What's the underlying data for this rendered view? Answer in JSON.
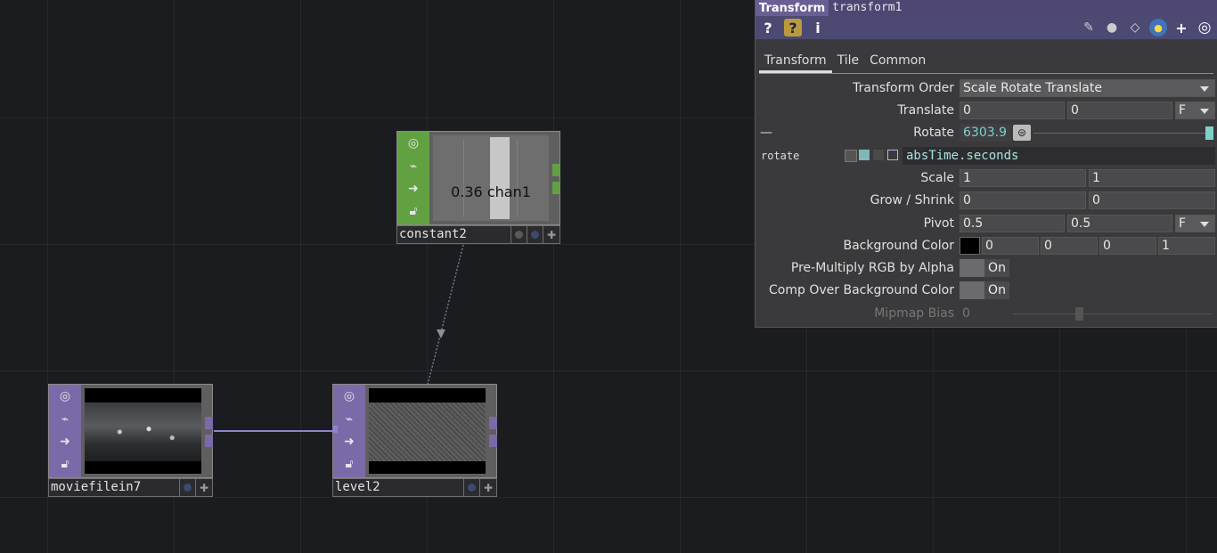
{
  "nodes": {
    "constant2": {
      "name": "constant2",
      "value_label": "0.36 chan1",
      "color": "#5f9d3c"
    },
    "moviefilein7": {
      "name": "moviefilein7",
      "color": "#7a6aa8"
    },
    "level2": {
      "name": "level2",
      "color": "#7a6aa8"
    }
  },
  "panel": {
    "op_type": "Transform",
    "op_name": "transform1",
    "toolbar_left": [
      "?",
      "?",
      "i"
    ],
    "tabs": [
      "Transform",
      "Tile",
      "Common"
    ],
    "active_tab": "Transform",
    "params": {
      "transform_order": {
        "label": "Transform Order",
        "value": "Scale Rotate Translate"
      },
      "translate": {
        "label": "Translate",
        "values": [
          "0",
          "0"
        ],
        "unit": "F"
      },
      "rotate": {
        "label": "Rotate",
        "value": "6303.9",
        "collapse": "—",
        "expr_name": "rotate",
        "expression": "absTime.seconds"
      },
      "scale": {
        "label": "Scale",
        "values": [
          "1",
          "1"
        ]
      },
      "grow_shrink": {
        "label": "Grow / Shrink",
        "values": [
          "0",
          "0"
        ]
      },
      "pivot": {
        "label": "Pivot",
        "values": [
          "0.5",
          "0.5"
        ],
        "unit": "F"
      },
      "bg_color": {
        "label": "Background Color",
        "values": [
          "0",
          "0",
          "0",
          "1"
        ],
        "swatch": "#000000"
      },
      "premultiply": {
        "label": "Pre-Multiply RGB by Alpha",
        "value": "On"
      },
      "comp_over": {
        "label": "Comp Over Background Color",
        "value": "On"
      },
      "mipmap": {
        "label": "Mipmap Bias",
        "value": "0",
        "slider_fraction": 0.33
      }
    }
  }
}
